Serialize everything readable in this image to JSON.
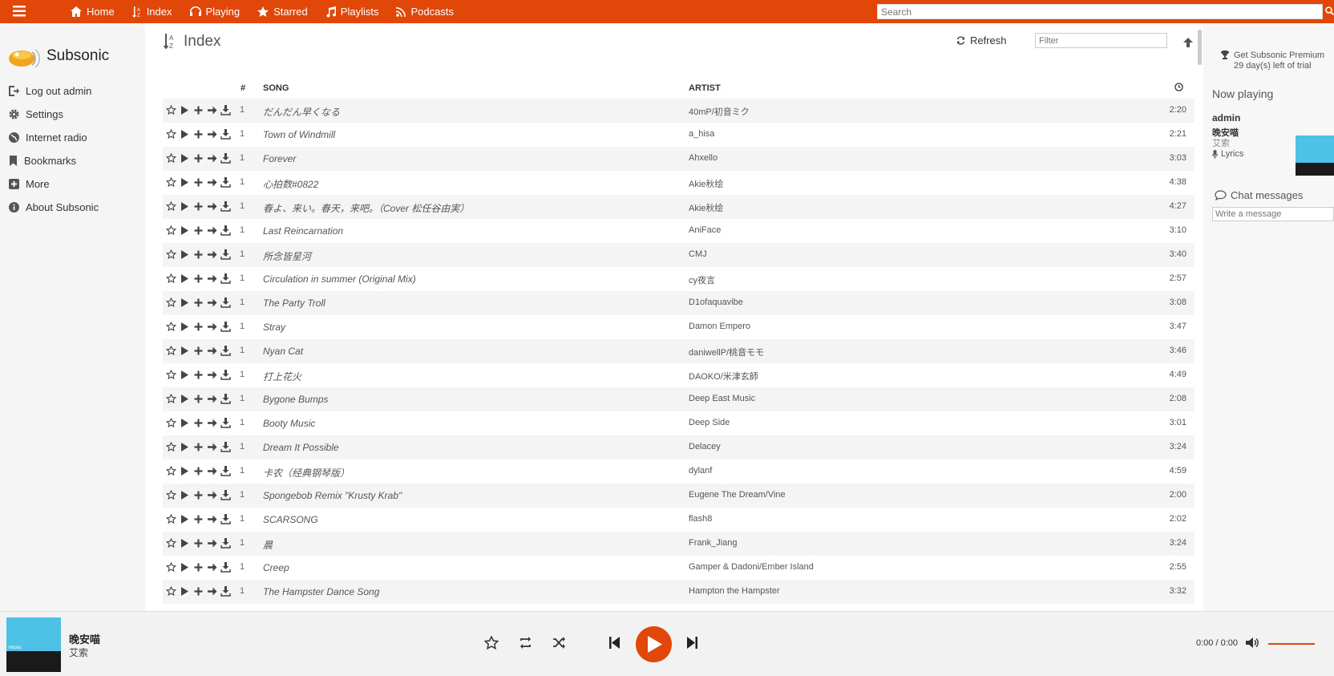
{
  "topnav": {
    "items": [
      {
        "label": "Home",
        "icon": "home-icon"
      },
      {
        "label": "Index",
        "icon": "sort-alpha-icon"
      },
      {
        "label": "Playing",
        "icon": "headphones-icon"
      },
      {
        "label": "Starred",
        "icon": "star-icon"
      },
      {
        "label": "Playlists",
        "icon": "music-note-icon"
      },
      {
        "label": "Podcasts",
        "icon": "rss-icon"
      }
    ],
    "search_placeholder": "Search"
  },
  "sidebar": {
    "brand": "Subsonic",
    "items": [
      {
        "label": "Log out admin",
        "icon": "logout-icon"
      },
      {
        "label": "Settings",
        "icon": "gear-icon"
      },
      {
        "label": "Internet radio",
        "icon": "globe-icon"
      },
      {
        "label": "Bookmarks",
        "icon": "bookmark-icon"
      },
      {
        "label": "More",
        "icon": "plus-square-icon"
      },
      {
        "label": "About Subsonic",
        "icon": "info-icon"
      }
    ]
  },
  "main": {
    "title": "Index",
    "refresh_label": "Refresh",
    "filter_placeholder": "Filter",
    "columns": {
      "num": "#",
      "song": "SONG",
      "artist": "ARTIST"
    },
    "rows": [
      {
        "num": "1",
        "song": "だんだん早くなる",
        "artist": "40mP/初音ミク",
        "duration": "2:20"
      },
      {
        "num": "1",
        "song": "Town of Windmill",
        "artist": "a_hisa",
        "duration": "2:21"
      },
      {
        "num": "1",
        "song": "Forever",
        "artist": "Ahxello",
        "duration": "3:03"
      },
      {
        "num": "1",
        "song": "心拍数#0822",
        "artist": "Akie秋绘",
        "duration": "4:38"
      },
      {
        "num": "1",
        "song": "春よ、来い。春天，来吧。（Cover 松任谷由実）",
        "artist": "Akie秋绘",
        "duration": "4:27"
      },
      {
        "num": "1",
        "song": "Last Reincarnation",
        "artist": "AniFace",
        "duration": "3:10"
      },
      {
        "num": "1",
        "song": "所念皆星河",
        "artist": "CMJ",
        "duration": "3:40"
      },
      {
        "num": "1",
        "song": "Circulation in summer (Original Mix)",
        "artist": "cy夜言",
        "duration": "2:57"
      },
      {
        "num": "1",
        "song": "The Party Troll",
        "artist": "D1ofaquavibe",
        "duration": "3:08"
      },
      {
        "num": "1",
        "song": "Stray",
        "artist": "Damon Empero",
        "duration": "3:47"
      },
      {
        "num": "1",
        "song": "Nyan Cat",
        "artist": "daniwellP/桃音モモ",
        "duration": "3:46"
      },
      {
        "num": "1",
        "song": "打上花火",
        "artist": "DAOKO/米津玄師",
        "duration": "4:49"
      },
      {
        "num": "1",
        "song": "Bygone Bumps",
        "artist": "Deep East Music",
        "duration": "2:08"
      },
      {
        "num": "1",
        "song": "Booty Music",
        "artist": "Deep Side",
        "duration": "3:01"
      },
      {
        "num": "1",
        "song": "Dream It Possible",
        "artist": "Delacey",
        "duration": "3:24"
      },
      {
        "num": "1",
        "song": "卡农（经典钢琴版）",
        "artist": "dylanf",
        "duration": "4:59"
      },
      {
        "num": "1",
        "song": "Spongebob Remix \"Krusty Krab\"",
        "artist": "Eugene The Dream/Vine",
        "duration": "2:00"
      },
      {
        "num": "1",
        "song": "SCARSONG",
        "artist": "flash8",
        "duration": "2:02"
      },
      {
        "num": "1",
        "song": "晨",
        "artist": "Frank_Jiang",
        "duration": "3:24"
      },
      {
        "num": "1",
        "song": "Creep",
        "artist": "Gamper & Dadoni/Ember Island",
        "duration": "2:55"
      },
      {
        "num": "1",
        "song": "The Hampster Dance Song",
        "artist": "Hampton the Hampster",
        "duration": "3:32"
      }
    ]
  },
  "right": {
    "premium_line1": "Get Subsonic Premium",
    "premium_line2": "29 day(s) left of trial",
    "now_playing_title": "Now playing",
    "np_user": "admin",
    "np_song": "晚安喵",
    "np_artist": "艾索",
    "np_lyrics": "Lyrics",
    "chat_title": "Chat messages",
    "chat_placeholder": "Write a message"
  },
  "player": {
    "art_label": "music",
    "title": "晚安喵",
    "artist": "艾索",
    "time": "0:00 / 0:00"
  },
  "colors": {
    "accent": "#e2470a"
  }
}
